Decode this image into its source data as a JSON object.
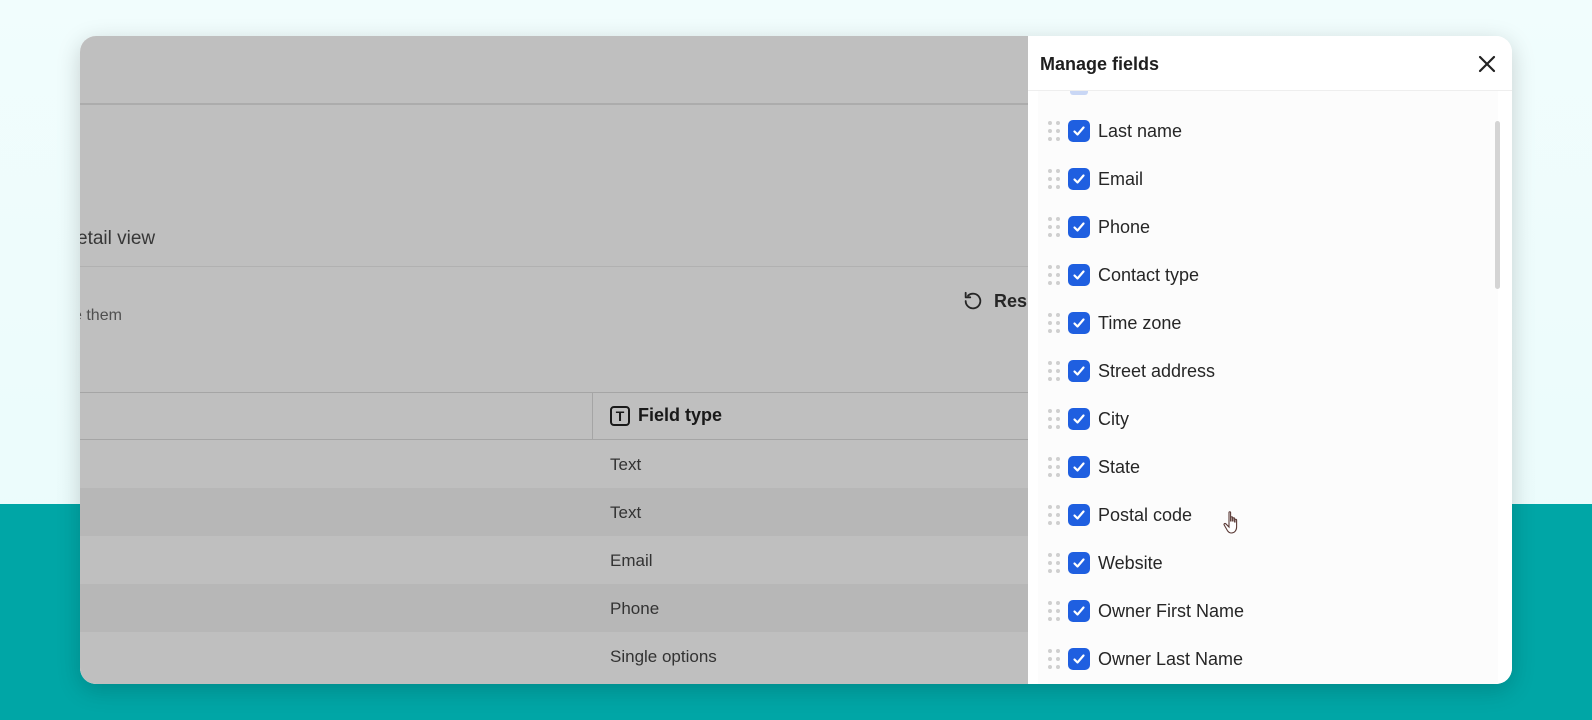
{
  "background": {
    "top_color": "#eefcfc",
    "band_color": "#00a6a6"
  },
  "main": {
    "detail_heading": "etail view",
    "subtext": "e them",
    "reset_label": "Res",
    "table": {
      "field_type_header": "Field type",
      "field_type_icon": "T",
      "rows": [
        "Text",
        "Text",
        "Email",
        "Phone",
        "Single options"
      ]
    }
  },
  "panel": {
    "title": "Manage fields",
    "close_icon": "close-icon",
    "accent_color": "#1f5fe0",
    "fields": [
      {
        "label": "Last name",
        "checked": true
      },
      {
        "label": "Email",
        "checked": true
      },
      {
        "label": "Phone",
        "checked": true
      },
      {
        "label": "Contact type",
        "checked": true
      },
      {
        "label": "Time zone",
        "checked": true
      },
      {
        "label": "Street address",
        "checked": true
      },
      {
        "label": "City",
        "checked": true
      },
      {
        "label": "State",
        "checked": true
      },
      {
        "label": "Postal code",
        "checked": true
      },
      {
        "label": "Website",
        "checked": true
      },
      {
        "label": "Owner First Name",
        "checked": true
      },
      {
        "label": "Owner Last Name",
        "checked": true
      }
    ]
  }
}
